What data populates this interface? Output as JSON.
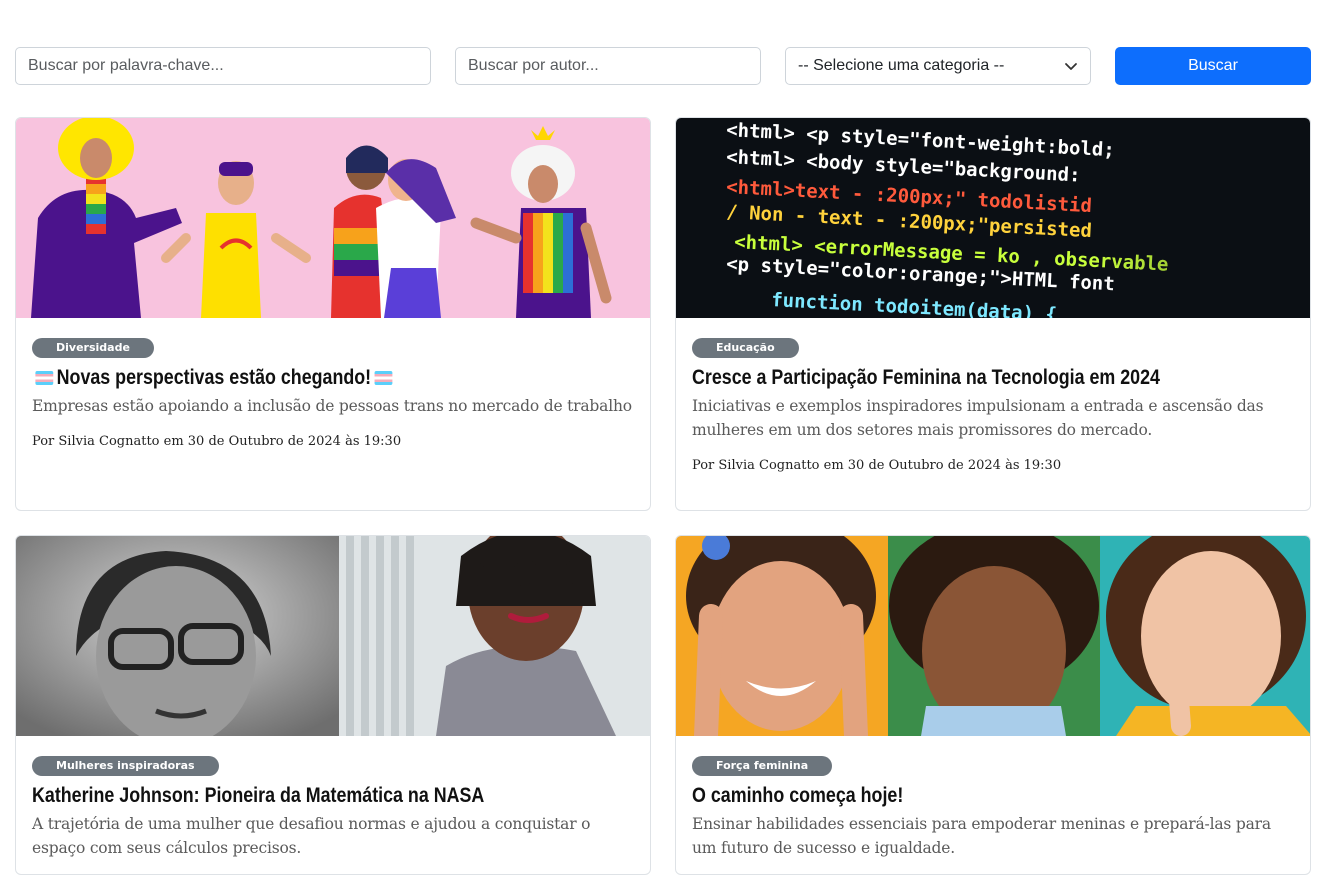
{
  "search": {
    "keyword_placeholder": "Buscar por palavra-chave...",
    "author_placeholder": "Buscar por autor...",
    "category_selected": "-- Selecione uma categoria --",
    "button_label": "Buscar"
  },
  "colors": {
    "primary": "#0d6efd",
    "badge": "#6c757d"
  },
  "cards": [
    {
      "category": "Diversidade",
      "title": "Novas perspectivas estão chegando!",
      "title_flag": "transgender-flag-emoji",
      "description": "Empresas estão apoiando a inclusão de pessoas trans no mercado de trabalho",
      "meta": "Por Silvia Cognatto em 30 de Outubro de 2024 às 19:30",
      "image": "illustration-lgbt-people"
    },
    {
      "category": "Educação",
      "title": "Cresce a Participação Feminina na Tecnologia em 2024",
      "description": "Iniciativas e exemplos inspiradores impulsionam a entrada e ascensão das mulheres em um dos setores mais promissores do mercado.",
      "meta": "Por Silvia Cognatto em 30 de Outubro de 2024 às 19:30",
      "image": "code-screen-photo"
    },
    {
      "category": "Mulheres inspiradoras",
      "title": "Katherine Johnson: Pioneira da Matemática na NASA",
      "description": "A trajetória de uma mulher que desafiou normas e ajudou a conquistar o espaço com seus cálculos precisos.",
      "image": "katherine-johnson-photo"
    },
    {
      "category": "Força feminina",
      "title": "O caminho começa hoje!",
      "description": "Ensinar habilidades essenciais para empoderar meninas e prepará-las para um futuro de sucesso e igualdade.",
      "image": "girls-portraits-photo"
    }
  ],
  "code_lines": [
    "<html> <p style=\"font-weight:bold;",
    "<html> <body style=\"background:",
    "<html>text - :200px;\" todolistid",
    "/ Non - text - :200px;\"persisted",
    "<html> <errorMessage = ko , observable",
    "<p style=\"color:orange;\">HTML font",
    "function todoitem(data) {"
  ]
}
